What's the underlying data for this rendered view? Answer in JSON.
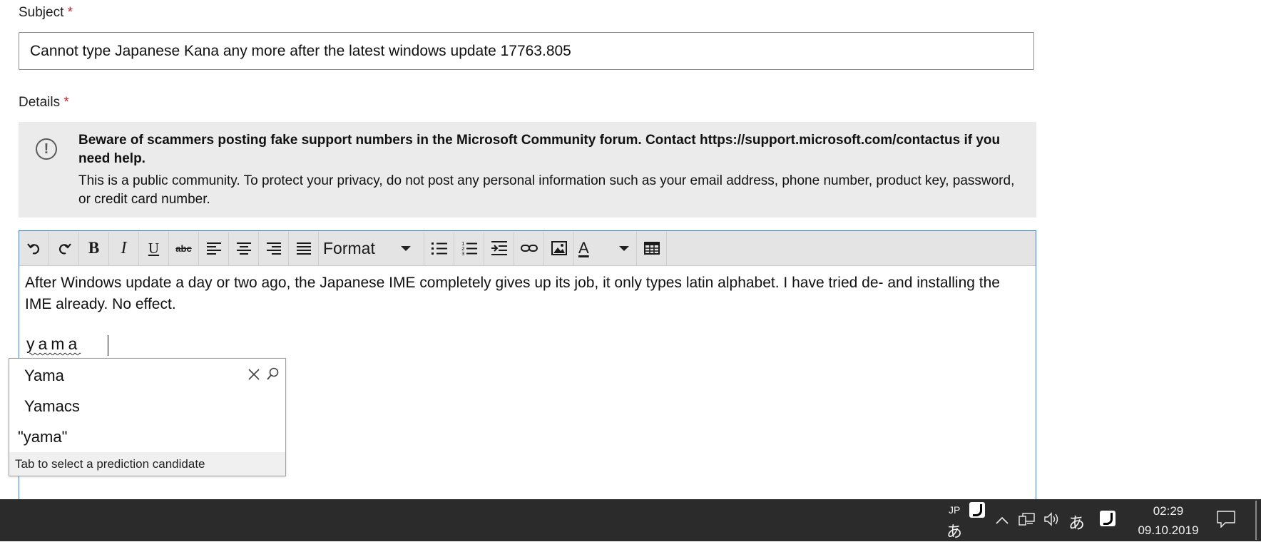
{
  "subject": {
    "label": "Subject",
    "required_mark": "*",
    "value": "Cannot type Japanese Kana any more after the latest windows update 17763.805"
  },
  "details": {
    "label": "Details",
    "required_mark": "*"
  },
  "notice": {
    "icon": "exclamation-circle-icon",
    "bold_text": "Beware of scammers posting fake support numbers in the Microsoft Community forum. Contact https://support.microsoft.com/contactus if you need help.",
    "text": "This is a public community. To protect your privacy, do not post any personal information such as your email address, phone number, product key, password, or credit card number."
  },
  "toolbar": {
    "format_label": "Format",
    "items": [
      "undo-icon",
      "redo-icon",
      "bold-icon",
      "italic-icon",
      "underline-icon",
      "strikethrough-icon",
      "align-left-icon",
      "align-center-icon",
      "align-right-icon",
      "justify-icon",
      "format-dropdown",
      "bulleted-list-icon",
      "numbered-list-icon",
      "indent-icon",
      "link-icon",
      "image-icon",
      "font-color-icon",
      "table-icon"
    ],
    "bold_glyph": "B",
    "italic_glyph": "I",
    "underline_glyph": "U",
    "strike_glyph": "abc",
    "font_color_glyph": "A"
  },
  "editor": {
    "body": "After Windows update a day or two ago, the Japanese IME completely gives up its job, it only types latin alphabet. I have tried de- and installing the IME already. No effect.",
    "composition": "yama"
  },
  "ime_popup": {
    "candidates": [
      "Yama",
      "Yamacs",
      "\"yama\""
    ],
    "footer": "Tab to select a prediction candidate"
  },
  "taskbar": {
    "input_lang": "JP",
    "ime_mode_glyph": "あ",
    "ime_mode_glyph_2": "あ",
    "time": "02:29",
    "date": "09.10.2019",
    "accent": "#2b2b2b"
  }
}
